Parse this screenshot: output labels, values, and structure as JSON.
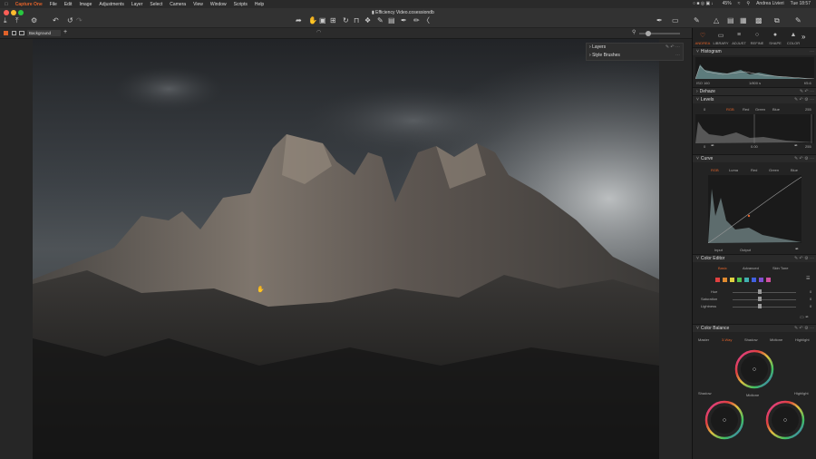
{
  "menubar": {
    "app": "Capture One",
    "items": [
      "File",
      "Edit",
      "Image",
      "Adjustments",
      "Layer",
      "Select",
      "Camera",
      "View",
      "Window",
      "Scripts",
      "Help"
    ],
    "battery": "45%",
    "user": "Andrea Livieri",
    "time": "Tue 18:57"
  },
  "window": {
    "title": "Efficiency Video.cosessiondb"
  },
  "subbar": {
    "layer": "Background"
  },
  "layers_panel": {
    "layers": "Layers",
    "style_brushes": "Style Brushes"
  },
  "panel_tabs": [
    {
      "label": "ANDREA",
      "icon": "heart-icon"
    },
    {
      "label": "LIBRARY",
      "icon": "folder-icon"
    },
    {
      "label": "ADJUST",
      "icon": "sliders-icon"
    },
    {
      "label": "REFINE",
      "icon": "circle-icon"
    },
    {
      "label": "SHAPE",
      "icon": "person-icon"
    },
    {
      "label": "COLOR",
      "icon": "palette-icon"
    }
  ],
  "histogram": {
    "title": "Histogram",
    "iso": "ISO 160",
    "shutter": "1/800 s",
    "aperture": "f/5.6"
  },
  "dehaze": {
    "title": "Dehaze"
  },
  "levels": {
    "title": "Levels",
    "tabs": [
      "RGB",
      "Red",
      "Green",
      "Blue"
    ],
    "in_low": "0",
    "in_high": "255",
    "out_low": "0",
    "mid": "0.00",
    "out_high": "255"
  },
  "curve": {
    "title": "Curve",
    "tabs": [
      "RGB",
      "Luma",
      "Red",
      "Green",
      "Blue"
    ],
    "input": "Input",
    "output": "Output"
  },
  "color_editor": {
    "title": "Color Editor",
    "tabs": [
      "Basic",
      "Advanced",
      "Skin Tone"
    ],
    "rows": [
      {
        "label": "Hue",
        "value": "0"
      },
      {
        "label": "Saturation",
        "value": "0"
      },
      {
        "label": "Lightness",
        "value": "0"
      }
    ],
    "swatches": [
      "#e04040",
      "#e08a30",
      "#e0d040",
      "#50c050",
      "#40b0b0",
      "#4060e0",
      "#8050d0",
      "#d050a0"
    ]
  },
  "color_balance": {
    "title": "Color Balance",
    "tabs": [
      "Master",
      "3-Way",
      "Shadow",
      "Midtone",
      "Highlight"
    ],
    "wheels": [
      "Shadow",
      "Midtone",
      "Highlight"
    ]
  }
}
